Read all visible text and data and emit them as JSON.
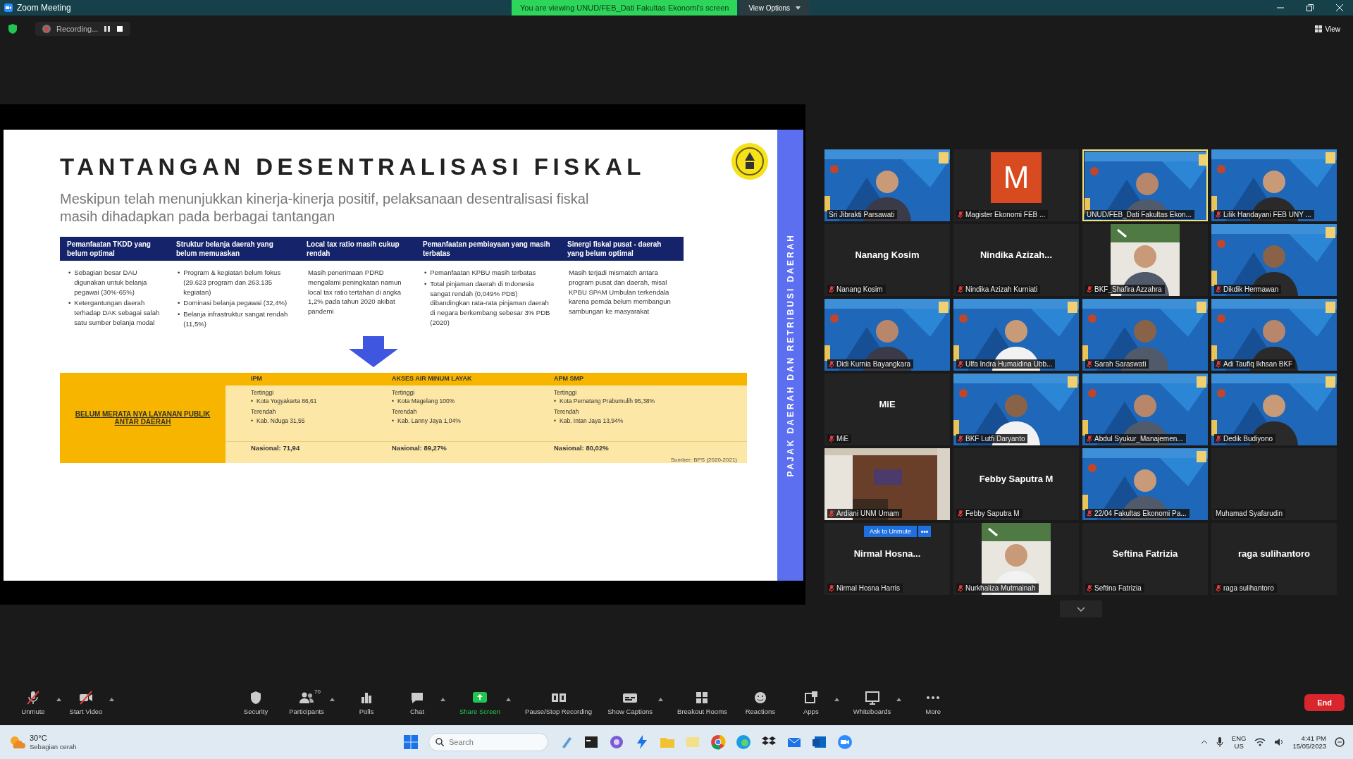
{
  "window": {
    "title": "Zoom Meeting"
  },
  "share_banner": "You are viewing UNUD/FEB_Dati Fakultas Ekonomi's screen",
  "view_options": "View Options",
  "recording": "Recording...",
  "view_button": "View",
  "slide": {
    "marker": "•",
    "title": "TANTANGAN DESENTRALISASI FISKAL",
    "subtitle": "Meskipun telah menunjukkan kinerja-kinerja positif, pelaksanaan desentralisasi fiskal masih dihadapkan pada berbagai tantangan",
    "side_label": "PAJAK DAERAH DAN RETRIBUSI DAERAH",
    "challenges": [
      {
        "heading": "Pemanfaatan TKDD yang belum optimal",
        "kind": "bullets",
        "items": [
          "Sebagian besar DAU digunakan untuk belanja pegawai (30%-65%)",
          "Ketergantungan daerah terhadap DAK sebagai salah satu sumber belanja modal"
        ]
      },
      {
        "heading": "Struktur belanja daerah yang belum memuaskan",
        "kind": "bullets",
        "items": [
          "Program & kegiatan belum fokus (29.623 program dan 263.135 kegiatan)",
          "Dominasi belanja pegawai (32,4%)",
          "Belanja infrastruktur sangat rendah (11,5%)"
        ]
      },
      {
        "heading": "Local tax ratio masih cukup rendah",
        "kind": "paragraph",
        "items": [
          "Masih penerimaan PDRD mengalami peningkatan namun local tax ratio tertahan di angka 1,2% pada tahun 2020 akibat pandemi"
        ]
      },
      {
        "heading": "Pemanfaatan pembiayaan yang masih terbatas",
        "kind": "bullets",
        "items": [
          "Pemanfaatan KPBU masih terbatas",
          "Total pinjaman daerah di Indonesia sangat rendah (0,049% PDB) dibandingkan rata-rata pinjaman daerah di negara berkembang sebesar 3% PDB (2020)"
        ]
      },
      {
        "heading": "Sinergi fiskal pusat - daerah yang belum optimal",
        "kind": "paragraph",
        "items": [
          "Masih terjadi mismatch antara program pusat dan daerah, misal KPBU SPAM Umbulan terkendala karena pemda belum membangun sambungan ke masyarakat"
        ]
      }
    ],
    "summary": {
      "label": "BELUM MERATA NYA LAYANAN PUBLIK ANTAR DAERAH",
      "source": "Sumber: BPS (2020-2021)",
      "columns": [
        {
          "heading": "IPM",
          "highest_label": "Tertinggi",
          "highest": "Kota Yogyakarta 86,61",
          "lowest_label": "Terendah",
          "lowest": "Kab. Nduga 31,55",
          "national": "Nasional: 71,94"
        },
        {
          "heading": "AKSES AIR MINUM LAYAK",
          "highest_label": "Tertinggi",
          "highest": "Kota Magelang 100%",
          "lowest_label": "Terendah",
          "lowest": "Kab. Lanny Jaya 1,04%",
          "national": "Nasional: 89,27%"
        },
        {
          "heading": "APM SMP",
          "highest_label": "Tertinggi",
          "highest": "Kota Pematang Prabumulih 95,38%",
          "lowest_label": "Terendah",
          "lowest": "Kab. Intan Jaya 13,94%",
          "national": "Nasional: 80,02%"
        }
      ]
    }
  },
  "participants": [
    {
      "name": "Sri Jibrakti Parsawati",
      "kind": "banner",
      "muted": false,
      "speaking": false
    },
    {
      "name": "Magister Ekonomi FEB ...",
      "kind": "avatar",
      "initial": "M",
      "muted": true,
      "speaking": false
    },
    {
      "name": "UNUD/FEB_Dati Fakultas Ekon...",
      "kind": "banner",
      "muted": false,
      "speaking": true
    },
    {
      "name": "Lilik Handayani FEB UNY ...",
      "kind": "banner",
      "muted": true,
      "speaking": false
    },
    {
      "name": "Nanang Kosim",
      "kind": "name",
      "big_name": "Nanang Kosim",
      "muted": true,
      "speaking": false
    },
    {
      "name": "Nindika Azizah Kurniati",
      "kind": "name",
      "big_name": "Nindika Azizah...",
      "muted": true,
      "speaking": false
    },
    {
      "name": "BKF_Shafira Azzahra",
      "kind": "webcam",
      "muted": true,
      "speaking": false
    },
    {
      "name": "Dikdik Hermawan",
      "kind": "banner",
      "muted": true,
      "speaking": false
    },
    {
      "name": "Didi Kurnia Bayangkara",
      "kind": "banner",
      "muted": true,
      "speaking": false
    },
    {
      "name": "Ulfa Indra Humaidina Ubb...",
      "kind": "banner",
      "muted": true,
      "speaking": false
    },
    {
      "name": "Sarah Saraswati",
      "kind": "banner",
      "muted": true,
      "speaking": false
    },
    {
      "name": "Adi Taufiq Ikhsan BKF",
      "kind": "banner",
      "muted": true,
      "speaking": false
    },
    {
      "name": "MiE",
      "kind": "name",
      "big_name": "MiE",
      "muted": true,
      "speaking": false
    },
    {
      "name": "BKF Lutfi Daryanto",
      "kind": "banner",
      "muted": true,
      "speaking": false
    },
    {
      "name": "Abdul Syukur_Manajemen...",
      "kind": "banner",
      "muted": true,
      "speaking": false
    },
    {
      "name": "Dedik Budiyono",
      "kind": "banner",
      "muted": true,
      "speaking": false
    },
    {
      "name": "Ardiani UNM Umam",
      "kind": "room",
      "muted": true,
      "speaking": false
    },
    {
      "name": "Febby Saputra M",
      "kind": "name",
      "big_name": "Febby Saputra M",
      "muted": true,
      "speaking": false
    },
    {
      "name": "22/04 Fakultas Ekonomi Pa...",
      "kind": "banner",
      "muted": true,
      "speaking": false
    },
    {
      "name": "Muhamad Syafarudin",
      "kind": "name",
      "muted": false,
      "speaking": false
    },
    {
      "name": "Nirmal Hosna Harris",
      "kind": "name",
      "big_name": "Nirmal Hosna...",
      "ask_unmute": "Ask to Unmute",
      "muted": true,
      "speaking": false
    },
    {
      "name": "Nurkhaliza Mutmainah",
      "kind": "webcam",
      "muted": true,
      "speaking": false
    },
    {
      "name": "Seftina Fatrizia",
      "kind": "name",
      "big_name": "Seftina Fatrizia",
      "muted": true,
      "speaking": false
    },
    {
      "name": "raga sulihantoro",
      "kind": "name",
      "big_name": "raga sulihantoro",
      "muted": true,
      "speaking": false
    }
  ],
  "toolbar": [
    {
      "kind": "mic",
      "label": "Unmute",
      "menu": true
    },
    {
      "kind": "video",
      "label": "Start Video",
      "menu": true
    },
    {
      "kind": "security",
      "label": "Security",
      "menu": false
    },
    {
      "kind": "participants",
      "label": "Participants",
      "menu": true,
      "count": "70"
    },
    {
      "kind": "polls",
      "label": "Polls",
      "menu": false
    },
    {
      "kind": "chat",
      "label": "Chat",
      "menu": true
    },
    {
      "kind": "share",
      "label": "Share Screen",
      "menu": true
    },
    {
      "kind": "record",
      "label": "Pause/Stop Recording",
      "menu": false
    },
    {
      "kind": "captions",
      "label": "Show Captions",
      "menu": true
    },
    {
      "kind": "breakout",
      "label": "Breakout Rooms",
      "menu": false
    },
    {
      "kind": "reactions",
      "label": "Reactions",
      "menu": false
    },
    {
      "kind": "apps",
      "label": "Apps",
      "menu": true
    },
    {
      "kind": "whiteboard",
      "label": "Whiteboards",
      "menu": true
    },
    {
      "kind": "more",
      "label": "More",
      "menu": false
    }
  ],
  "end_button": "End",
  "taskbar": {
    "temperature": "30°C",
    "weather": "Sebagian cerah",
    "search_placeholder": "Search",
    "language": "ENG",
    "region": "US",
    "time": "4:41 PM",
    "date": "15/05/2023"
  }
}
